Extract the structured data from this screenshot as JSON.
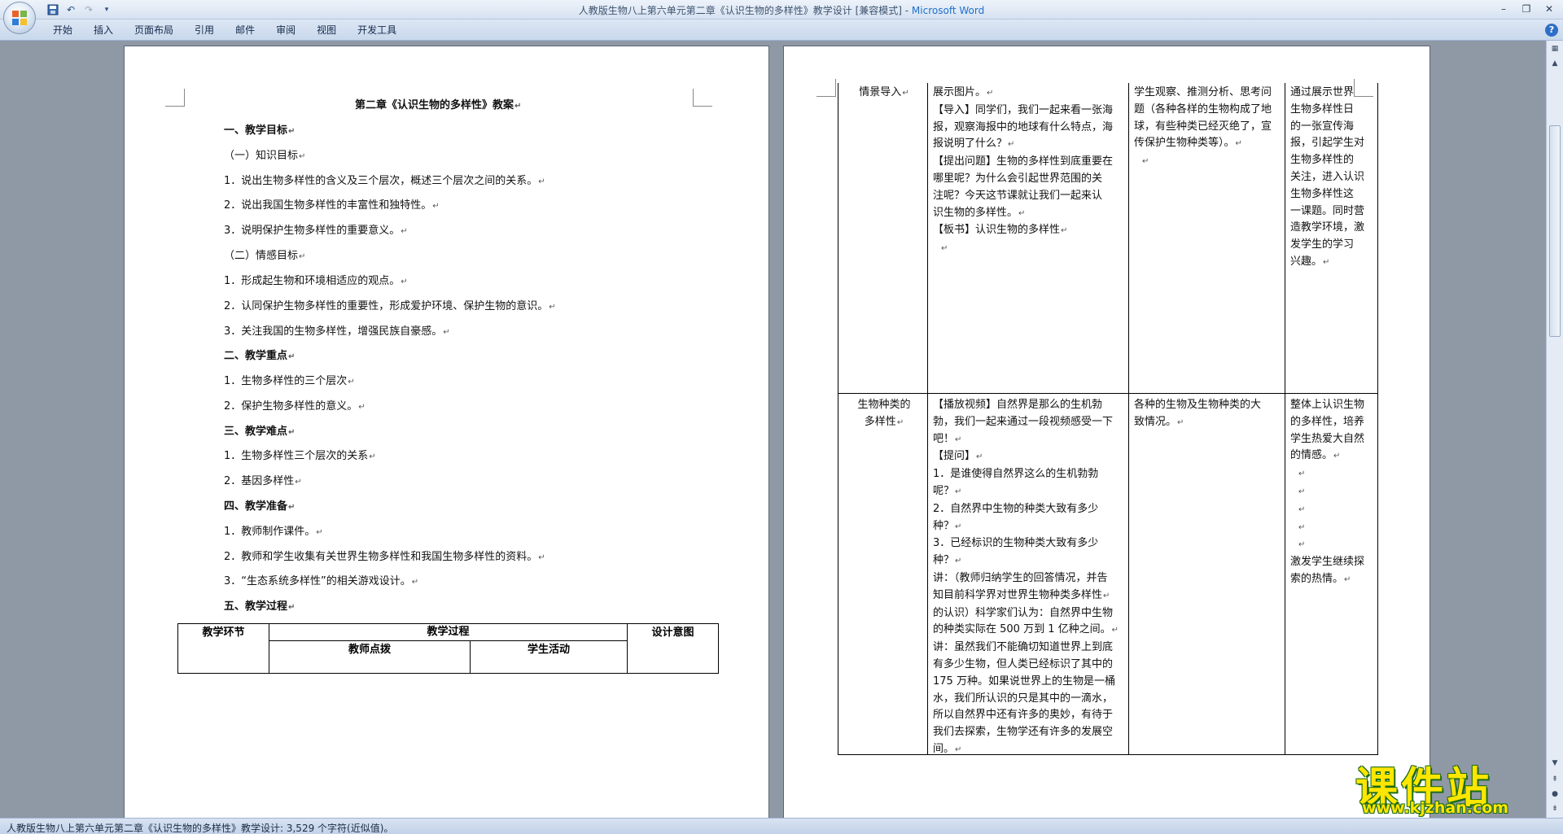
{
  "window": {
    "title_doc": "人教版生物八上第六单元第二章《认识生物的多样性》教学设计 [兼容模式] - ",
    "title_app": "Microsoft Word"
  },
  "qat": [
    "save-icon",
    "undo-icon",
    "redo-icon",
    "customize-icon"
  ],
  "ribbon": {
    "tabs": [
      "开始",
      "插入",
      "页面布局",
      "引用",
      "邮件",
      "审阅",
      "视图",
      "开发工具"
    ]
  },
  "left_page": {
    "lines": [
      {
        "text": "第二章《认识生物的多样性》教案",
        "bold": true
      },
      {
        "text": "一、教学目标",
        "bold": true
      },
      {
        "text": "（一）知识目标",
        "bold": false
      },
      {
        "text": "1．说出生物多样性的含义及三个层次，概述三个层次之间的关系。",
        "bold": false
      },
      {
        "text": "2．说出我国生物多样性的丰富性和独特性。",
        "bold": false
      },
      {
        "text": "3．说明保护生物多样性的重要意义。",
        "bold": false
      },
      {
        "text": "（二）情感目标",
        "bold": false
      },
      {
        "text": "1．形成起生物和环境相适应的观点。",
        "bold": false
      },
      {
        "text": "2．认同保护生物多样性的重要性，形成爱护环境、保护生物的意识。",
        "bold": false
      },
      {
        "text": "3．关注我国的生物多样性，增强民族自豪感。",
        "bold": false
      },
      {
        "text": "二、教学重点",
        "bold": true
      },
      {
        "text": "1．生物多样性的三个层次",
        "bold": false
      },
      {
        "text": "2．保护生物多样性的意义。",
        "bold": false
      },
      {
        "text": "三、教学难点",
        "bold": true
      },
      {
        "text": "1．生物多样性三个层次的关系",
        "bold": false
      },
      {
        "text": "2．基因多样性",
        "bold": false
      },
      {
        "text": "四、教学准备",
        "bold": true
      },
      {
        "text": "1．教师制作课件。",
        "bold": false
      },
      {
        "text": "2．教师和学生收集有关世界生物多样性和我国生物多样性的资料。",
        "bold": false
      },
      {
        "text": "3．“生态系统多样性”的相关游戏设计。",
        "bold": false
      },
      {
        "text": "五、教学过程",
        "bold": true
      }
    ],
    "table": {
      "col_step": "教学环节",
      "col_process": "教学过程",
      "col_intent": "设计意图",
      "sub_teacher": "教师点拨",
      "sub_student": "学生活动"
    }
  },
  "right_page": {
    "rows": [
      {
        "step": [
          "情景导入"
        ],
        "teacher": [
          "展示图片。",
          "【导入】同学们，我们一起来看一张海",
          "报，观察海报中的地球有什么特点，海",
          "报说明了什么？",
          "【提出问题】生物的多样性到底重要在",
          "哪里呢？为什么会引起世界范围的关",
          "注呢？今天这节课就让我们一起来认",
          "识生物的多样性。",
          "【板书】认识生物的多样性",
          ""
        ],
        "student": [
          "学生观察、推测分析、思考问",
          "题（各种各样的生物构成了地",
          "球，有些种类已经灭绝了，宣",
          "传保护生物种类等）。",
          ""
        ],
        "intent": [
          "通过展示世界",
          "生物多样性日",
          "的一张宣传海",
          "报，引起学生对",
          "生物多样性的",
          "关注，进入认识",
          "生物多样性这",
          "一课题。同时营",
          "造教学环境，激",
          "发学生的学习",
          "兴趣。"
        ]
      },
      {
        "step": [
          "生物种类的",
          "多样性"
        ],
        "teacher": [
          "【播放视频】自然界是那么的生机勃",
          "勃，我们一起来通过一段视频感受一下",
          "吧！",
          "【提问】",
          "1．是谁使得自然界这么的生机勃勃",
          "呢？",
          "2．自然界中生物的种类大致有多少",
          "种？",
          "3．已经标识的生物种类大致有多少",
          "种？",
          "讲：（教师归纳学生的回答情况，并告",
          "知目前科学界对世界生物种类多样性",
          "的认识）科学家们认为：自然界中生物",
          "的种类实际在 500 万到 1 亿种之间。",
          "讲：虽然我们不能确切知道世界上到底",
          "有多少生物，但人类已经标识了其中的",
          "175 万种。如果说世界上的生物是一桶",
          "水，我们所认识的只是其中的一滴水，",
          "所以自然界中还有许多的奥妙，有待于",
          "我们去探索，生物学还有许多的发展空",
          "间。"
        ],
        "student": [
          "各种的生物及生物种类的大",
          "致情况。"
        ],
        "intent": [
          "整体上认识生物",
          "的多样性，培养",
          "学生热爱大自然",
          "的情感。",
          "",
          "",
          "",
          "",
          "",
          "激发学生继续探",
          "索的热情。"
        ]
      }
    ]
  },
  "statusbar": {
    "text": "人教版生物八上第六单元第二章《认识生物的多样性》教学设计: 3,529 个字符(近似值)。"
  },
  "watermark": {
    "title": "课件站",
    "url": "www.kjzhan.com"
  },
  "colors": {
    "workspace": "#8f99a6",
    "ribbon": "#c9d8ec",
    "title_app": "#1f6fcc",
    "watermark_yellow": "#ffe600",
    "watermark_green": "#1b6b14"
  }
}
